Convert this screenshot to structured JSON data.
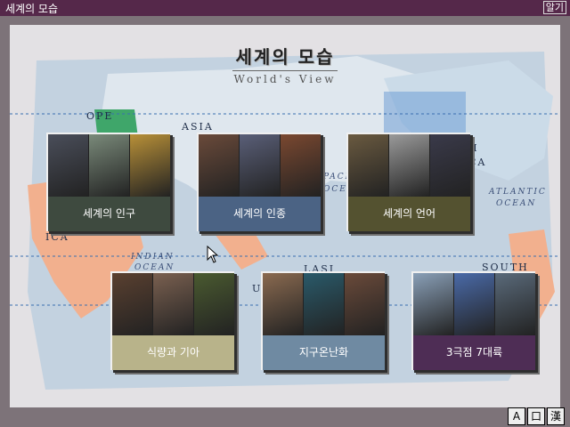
{
  "window": {
    "title": "세계의 모습",
    "close_label": "알기"
  },
  "header": {
    "title": "세계의 모습",
    "subtitle": "World's View"
  },
  "map_labels": {
    "europe": "OPE",
    "asia": "ASIA",
    "pacific": "PACI",
    "pacific_ocean": "OCE",
    "america": "CA",
    "north": "H",
    "atlantic": "ATLANTIC",
    "atlantic_ocean": "OCEAN",
    "indian": "INDIAN",
    "indian_ocean": "OCEAN",
    "africa": "ICA",
    "australia": "LASI",
    "south": "SOUTH",
    "us": "US"
  },
  "cards": [
    {
      "label": "세계의 인구",
      "color": "#3e4a3f",
      "photos": [
        "#4a4e5a",
        "#7a8a7a",
        "#b89038"
      ]
    },
    {
      "label": "세계의 인종",
      "color": "#4b6384",
      "photos": [
        "#6a4a3a",
        "#5a5f78",
        "#7a4830"
      ]
    },
    {
      "label": "세계의 언어",
      "color": "#545230",
      "photos": [
        "#6a5a40",
        "#9a9a9a",
        "#3a3a4a"
      ]
    },
    {
      "label": "식량과 기아",
      "color": "#b8b38a",
      "photos": [
        "#5a4030",
        "#7a6050",
        "#4a5a30"
      ]
    },
    {
      "label": "지구온난화",
      "color": "#6f8aa2",
      "photos": [
        "#8a6a50",
        "#2a5a6a",
        "#6a4a3a"
      ]
    },
    {
      "label": "3극점 7대륙",
      "color": "#4e2d55",
      "photos": [
        "#8aa0b8",
        "#4a6aa8",
        "#5a6a7a"
      ]
    }
  ],
  "keyboard": {
    "a_label": "A",
    "mid_label": "口",
    "han_label": "漢"
  }
}
